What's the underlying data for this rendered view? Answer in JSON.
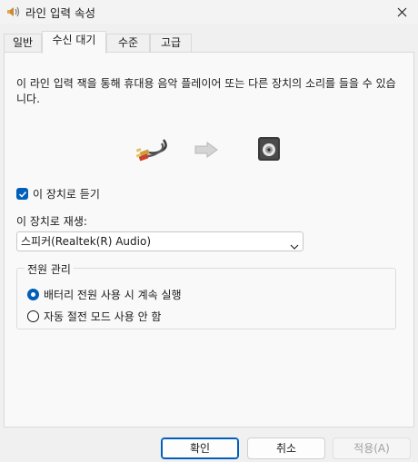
{
  "window": {
    "title": "라인 입력 속성",
    "title_icon": "speaker-icon",
    "close_icon": "close-icon"
  },
  "tabs": [
    {
      "label": "일반",
      "active": false
    },
    {
      "label": "수신 대기",
      "active": true
    },
    {
      "label": "수준",
      "active": false
    },
    {
      "label": "고급",
      "active": false
    }
  ],
  "listen": {
    "description": "이 라인 입력 잭을 통해 휴대용 음악 플레이어 또는 다른 장치의 소리를 들을 수 있습니다.",
    "icons": [
      "audio-cable-icon",
      "arrow-right-icon",
      "speaker-device-icon"
    ],
    "listen_checkbox_label": "이 장치로 듣기",
    "listen_checked": true,
    "playback_label": "이 장치로 재생:",
    "playback_device": "스피커(Realtek(R) Audio)"
  },
  "power": {
    "group_title": "전원 관리",
    "options": [
      {
        "label": "배터리 전원 사용 시 계속 실행",
        "selected": true
      },
      {
        "label": "자동 절전 모드 사용 안 함",
        "selected": false
      }
    ]
  },
  "buttons": {
    "ok": "확인",
    "cancel": "취소",
    "apply": "적용(A)"
  },
  "colors": {
    "accent": "#005fb8",
    "panel_bg": "#f9f9f9",
    "window_bg": "#f0f0f0"
  }
}
